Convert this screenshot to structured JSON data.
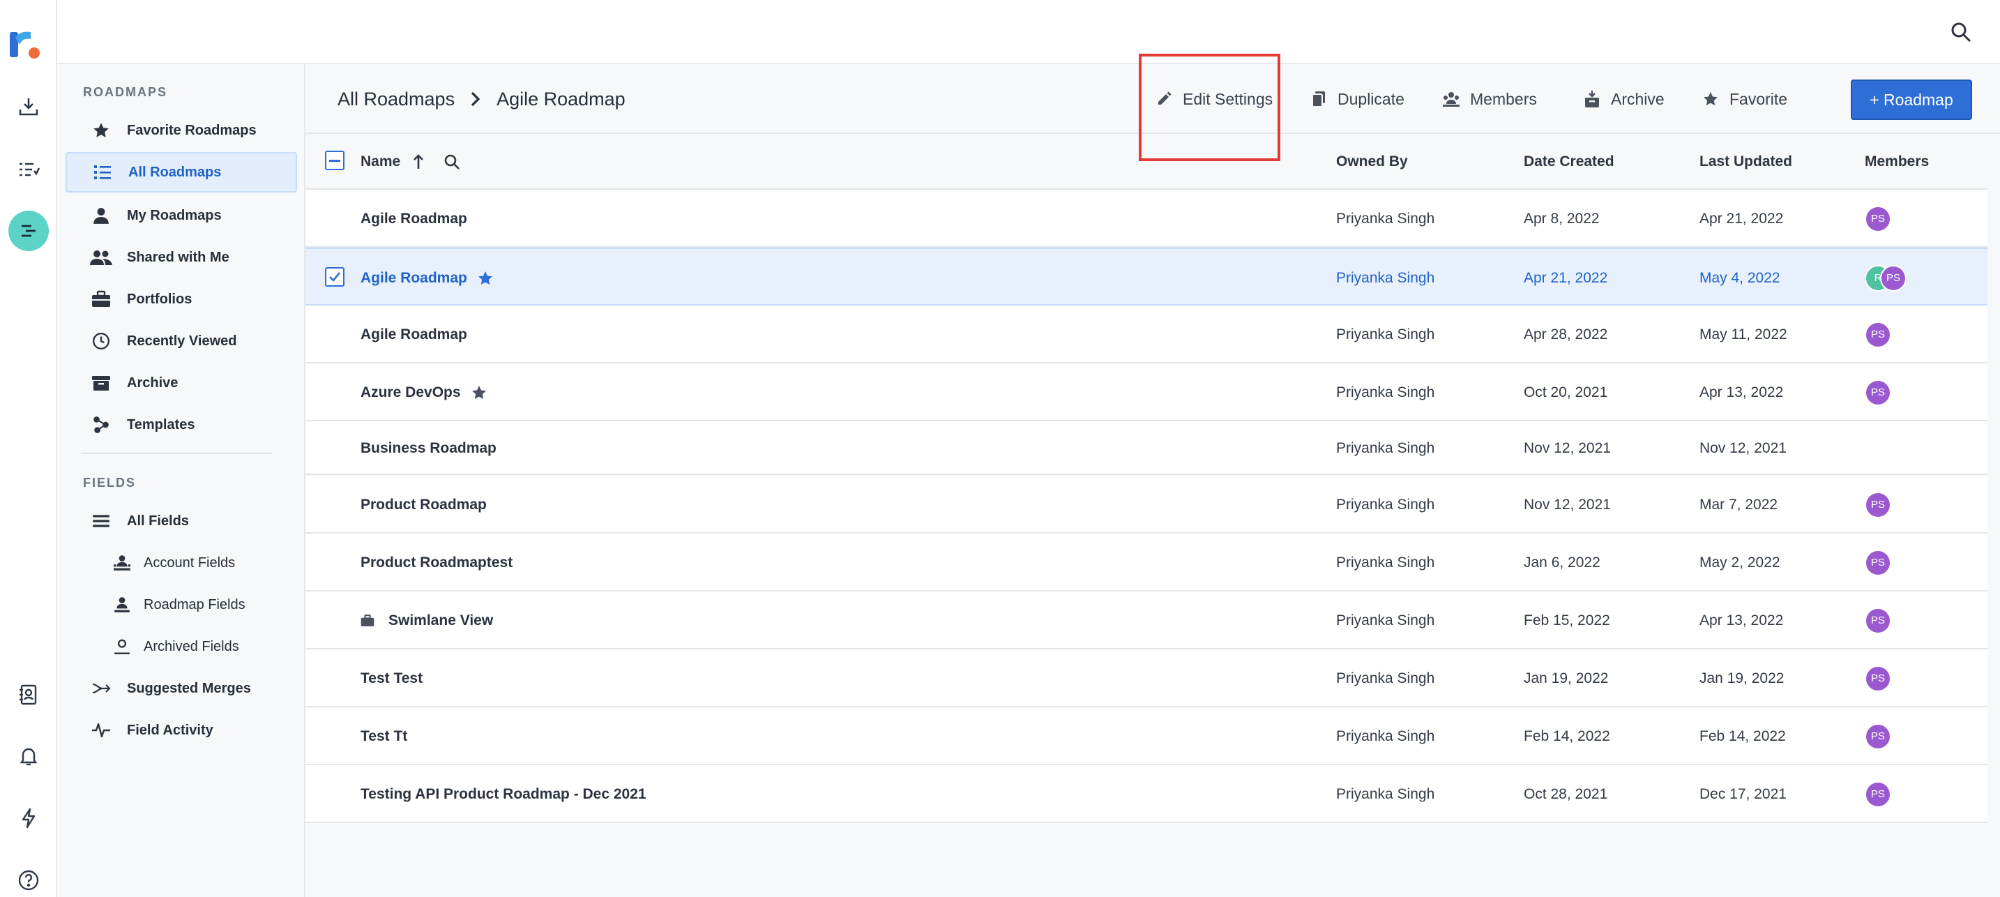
{
  "topbar": {
    "search_icon": "search-icon"
  },
  "rail": {
    "logo_letter": "r",
    "items": [
      {
        "icon": "download-icon"
      },
      {
        "icon": "list-check-icon"
      },
      {
        "icon": "roadmap-lines-icon",
        "active": true
      },
      {
        "icon": "contacts-book-icon"
      },
      {
        "icon": "bell-icon"
      },
      {
        "icon": "lightning-icon"
      },
      {
        "icon": "help-icon",
        "label": "?"
      }
    ]
  },
  "sidebar": {
    "roadmaps_title": "ROADMAPS",
    "fields_title": "FIELDS",
    "roadmap_items": [
      {
        "label": "Favorite Roadmaps",
        "icon": "star-icon"
      },
      {
        "label": "All Roadmaps",
        "icon": "list-icon",
        "active": true
      },
      {
        "label": "My Roadmaps",
        "icon": "person-icon"
      },
      {
        "label": "Shared with Me",
        "icon": "people-icon"
      },
      {
        "label": "Portfolios",
        "icon": "briefcase-icon"
      },
      {
        "label": "Recently Viewed",
        "icon": "clock-icon"
      },
      {
        "label": "Archive",
        "icon": "archive-box-icon"
      },
      {
        "label": "Templates",
        "icon": "template-nodes-icon"
      }
    ],
    "field_items": [
      {
        "label": "All Fields",
        "icon": "stack-lines-icon"
      },
      {
        "label": "Account Fields",
        "icon": "account-fields-icon"
      },
      {
        "label": "Roadmap Fields",
        "icon": "roadmap-fields-icon"
      },
      {
        "label": "Archived Fields",
        "icon": "archived-fields-icon"
      },
      {
        "label": "Suggested Merges",
        "icon": "merge-arrow-icon"
      },
      {
        "label": "Field Activity",
        "icon": "activity-pulse-icon"
      }
    ]
  },
  "breadcrumb": {
    "root": "All Roadmaps",
    "current": "Agile Roadmap"
  },
  "actions": {
    "edit_settings": "Edit Settings",
    "duplicate": "Duplicate",
    "members": "Members",
    "archive": "Archive",
    "favorite": "Favorite",
    "add_roadmap": "+ Roadmap"
  },
  "table": {
    "columns": {
      "name": "Name",
      "owned_by": "Owned By",
      "date_created": "Date Created",
      "last_updated": "Last Updated",
      "members": "Members"
    },
    "rows": [
      {
        "name": "Agile Roadmap",
        "owner": "Priyanka Singh",
        "created": "Apr 8, 2022",
        "updated": "Apr 21, 2022",
        "members": [
          "PS"
        ]
      },
      {
        "name": "Agile Roadmap",
        "owner": "Priyanka Singh",
        "created": "Apr 21, 2022",
        "updated": "May 4, 2022",
        "members": [
          "R",
          "PS"
        ],
        "selected": true,
        "favorite": true
      },
      {
        "name": "Agile Roadmap",
        "owner": "Priyanka Singh",
        "created": "Apr 28, 2022",
        "updated": "May 11, 2022",
        "members": [
          "PS"
        ]
      },
      {
        "name": "Azure DevOps",
        "owner": "Priyanka Singh",
        "created": "Oct 20, 2021",
        "updated": "Apr 13, 2022",
        "members": [
          "PS"
        ],
        "favorite": true
      },
      {
        "name": "Business Roadmap",
        "owner": "Priyanka Singh",
        "created": "Nov 12, 2021",
        "updated": "Nov 12, 2021",
        "members": []
      },
      {
        "name": "Product Roadmap",
        "owner": "Priyanka Singh",
        "created": "Nov 12, 2021",
        "updated": "Mar 7, 2022",
        "members": [
          "PS"
        ]
      },
      {
        "name": "Product Roadmaptest",
        "owner": "Priyanka Singh",
        "created": "Jan 6, 2022",
        "updated": "May 2, 2022",
        "members": [
          "PS"
        ]
      },
      {
        "name": "Swimlane View",
        "owner": "Priyanka Singh",
        "created": "Feb 15, 2022",
        "updated": "Apr 13, 2022",
        "members": [
          "PS"
        ],
        "portfolio": true
      },
      {
        "name": "Test Test",
        "owner": "Priyanka Singh",
        "created": "Jan 19, 2022",
        "updated": "Jan 19, 2022",
        "members": [
          "PS"
        ]
      },
      {
        "name": "Test Tt",
        "owner": "Priyanka Singh",
        "created": "Feb 14, 2022",
        "updated": "Feb 14, 2022",
        "members": [
          "PS"
        ]
      },
      {
        "name": "Testing API Product Roadmap - Dec 2021",
        "owner": "Priyanka Singh",
        "created": "Oct 28, 2021",
        "updated": "Dec 17, 2021",
        "members": [
          "PS"
        ]
      }
    ]
  },
  "colors": {
    "accent": "#2d6fd6",
    "rail_active": "#5cd3c6",
    "avatar": "#9b59d0",
    "highlight": "#e53935"
  }
}
